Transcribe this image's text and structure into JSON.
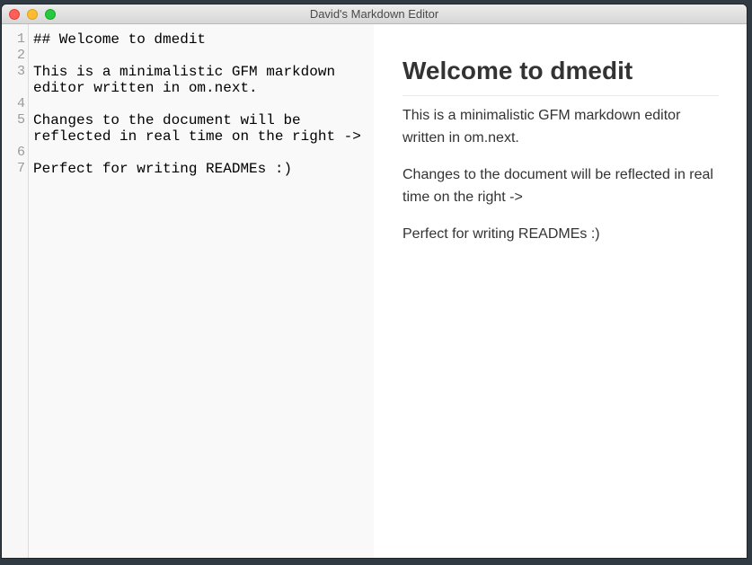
{
  "window": {
    "title": "David's Markdown Editor"
  },
  "editor": {
    "line_numbers": [
      "1",
      "2",
      "3",
      "",
      "4",
      "5",
      "",
      "6",
      "7"
    ],
    "lines": [
      "## Welcome to dmedit",
      "",
      "This is a minimalistic GFM markdown",
      "editor written in om.next.",
      "",
      "Changes to the document will be",
      "reflected in real time on the right ->",
      "",
      "Perfect for writing READMEs :)"
    ]
  },
  "preview": {
    "heading": "Welcome to dmedit",
    "paragraphs": [
      "This is a minimalistic GFM markdown editor written in om.next.",
      "Changes to the document will be reflected in real time on the right ->",
      "Perfect for writing READMEs :)"
    ]
  },
  "colors": {
    "close": "#fe5f57",
    "minimize": "#febc2e",
    "maximize": "#28c840",
    "editor_bg": "#f8f9f8",
    "preview_text": "#333333"
  }
}
